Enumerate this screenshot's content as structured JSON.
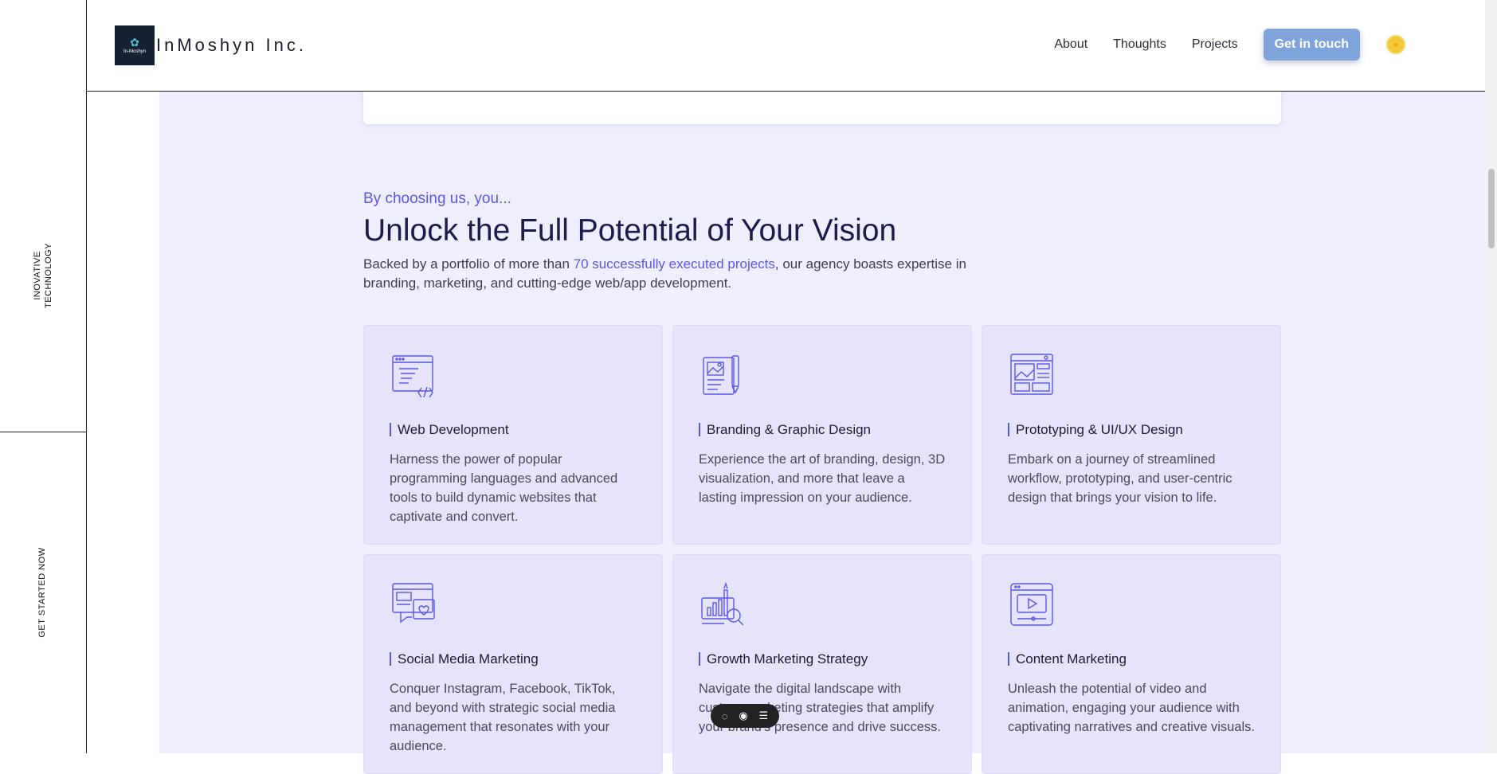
{
  "rail": {
    "top_label": "INOVATIVE TECHNOLOGY",
    "bottom_label": "GET STARTED NOW"
  },
  "header": {
    "logo_text": "In-Moshyn",
    "brand": "InMoshyn Inc.",
    "nav": [
      "About",
      "Thoughts",
      "Projects"
    ],
    "cta": "Get in touch"
  },
  "section": {
    "eyebrow": "By choosing us, you...",
    "headline": "Unlock the Full Potential of Your Vision",
    "lead_before": "Backed by a portfolio of more than ",
    "lead_highlight": "70 successfully executed projects",
    "lead_after": ", our agency boasts expertise in branding, marketing, and cutting-edge web/app development."
  },
  "cards": [
    {
      "icon": "code-window-icon",
      "title": "Web Development",
      "desc": "Harness the power of popular programming languages and advanced tools to build dynamic websites that captivate and convert."
    },
    {
      "icon": "design-board-icon",
      "title": "Branding & Graphic Design",
      "desc": "Experience the art of branding, design, 3D visualization, and more that leave a lasting impression on your audience."
    },
    {
      "icon": "wireframe-icon",
      "title": "Prototyping & UI/UX Design",
      "desc": "Embark on a journey of streamlined workflow, prototyping, and user-centric design that brings your vision to life."
    },
    {
      "icon": "social-media-icon",
      "title": "Social Media Marketing",
      "desc": "Conquer Instagram, Facebook, TikTok, and beyond with strategic social media management that resonates with your audience."
    },
    {
      "icon": "growth-chart-icon",
      "title": "Growth Marketing Strategy",
      "desc": "Navigate the digital landscape with custom marketing strategies that amplify your brand's presence and drive success."
    },
    {
      "icon": "video-player-icon",
      "title": "Content Marketing",
      "desc": "Unleash the potential of video and animation, engaging your audience with captivating narratives and creative visuals."
    }
  ],
  "colors": {
    "accent": "#5b58e3",
    "cta_bg": "#7fa4dc",
    "section_bg": "#eeeeff",
    "card_bg": "#e5e4fb"
  }
}
